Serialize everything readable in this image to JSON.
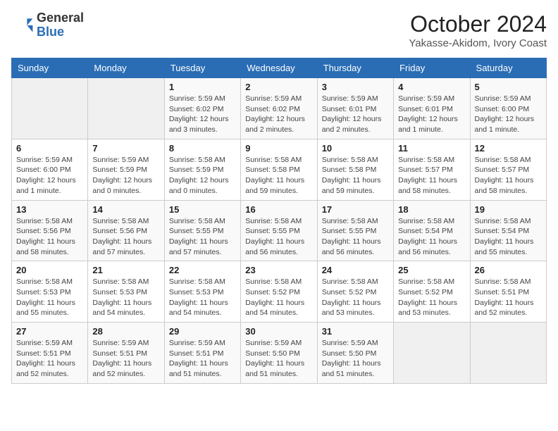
{
  "header": {
    "logo_general": "General",
    "logo_blue": "Blue",
    "month_year": "October 2024",
    "location": "Yakasse-Akidom, Ivory Coast"
  },
  "days_of_week": [
    "Sunday",
    "Monday",
    "Tuesday",
    "Wednesday",
    "Thursday",
    "Friday",
    "Saturday"
  ],
  "weeks": [
    [
      {
        "day": "",
        "detail": ""
      },
      {
        "day": "",
        "detail": ""
      },
      {
        "day": "1",
        "detail": "Sunrise: 5:59 AM\nSunset: 6:02 PM\nDaylight: 12 hours\nand 3 minutes."
      },
      {
        "day": "2",
        "detail": "Sunrise: 5:59 AM\nSunset: 6:02 PM\nDaylight: 12 hours\nand 2 minutes."
      },
      {
        "day": "3",
        "detail": "Sunrise: 5:59 AM\nSunset: 6:01 PM\nDaylight: 12 hours\nand 2 minutes."
      },
      {
        "day": "4",
        "detail": "Sunrise: 5:59 AM\nSunset: 6:01 PM\nDaylight: 12 hours\nand 1 minute."
      },
      {
        "day": "5",
        "detail": "Sunrise: 5:59 AM\nSunset: 6:00 PM\nDaylight: 12 hours\nand 1 minute."
      }
    ],
    [
      {
        "day": "6",
        "detail": "Sunrise: 5:59 AM\nSunset: 6:00 PM\nDaylight: 12 hours\nand 1 minute."
      },
      {
        "day": "7",
        "detail": "Sunrise: 5:59 AM\nSunset: 5:59 PM\nDaylight: 12 hours\nand 0 minutes."
      },
      {
        "day": "8",
        "detail": "Sunrise: 5:58 AM\nSunset: 5:59 PM\nDaylight: 12 hours\nand 0 minutes."
      },
      {
        "day": "9",
        "detail": "Sunrise: 5:58 AM\nSunset: 5:58 PM\nDaylight: 11 hours\nand 59 minutes."
      },
      {
        "day": "10",
        "detail": "Sunrise: 5:58 AM\nSunset: 5:58 PM\nDaylight: 11 hours\nand 59 minutes."
      },
      {
        "day": "11",
        "detail": "Sunrise: 5:58 AM\nSunset: 5:57 PM\nDaylight: 11 hours\nand 58 minutes."
      },
      {
        "day": "12",
        "detail": "Sunrise: 5:58 AM\nSunset: 5:57 PM\nDaylight: 11 hours\nand 58 minutes."
      }
    ],
    [
      {
        "day": "13",
        "detail": "Sunrise: 5:58 AM\nSunset: 5:56 PM\nDaylight: 11 hours\nand 58 minutes."
      },
      {
        "day": "14",
        "detail": "Sunrise: 5:58 AM\nSunset: 5:56 PM\nDaylight: 11 hours\nand 57 minutes."
      },
      {
        "day": "15",
        "detail": "Sunrise: 5:58 AM\nSunset: 5:55 PM\nDaylight: 11 hours\nand 57 minutes."
      },
      {
        "day": "16",
        "detail": "Sunrise: 5:58 AM\nSunset: 5:55 PM\nDaylight: 11 hours\nand 56 minutes."
      },
      {
        "day": "17",
        "detail": "Sunrise: 5:58 AM\nSunset: 5:55 PM\nDaylight: 11 hours\nand 56 minutes."
      },
      {
        "day": "18",
        "detail": "Sunrise: 5:58 AM\nSunset: 5:54 PM\nDaylight: 11 hours\nand 56 minutes."
      },
      {
        "day": "19",
        "detail": "Sunrise: 5:58 AM\nSunset: 5:54 PM\nDaylight: 11 hours\nand 55 minutes."
      }
    ],
    [
      {
        "day": "20",
        "detail": "Sunrise: 5:58 AM\nSunset: 5:53 PM\nDaylight: 11 hours\nand 55 minutes."
      },
      {
        "day": "21",
        "detail": "Sunrise: 5:58 AM\nSunset: 5:53 PM\nDaylight: 11 hours\nand 54 minutes."
      },
      {
        "day": "22",
        "detail": "Sunrise: 5:58 AM\nSunset: 5:53 PM\nDaylight: 11 hours\nand 54 minutes."
      },
      {
        "day": "23",
        "detail": "Sunrise: 5:58 AM\nSunset: 5:52 PM\nDaylight: 11 hours\nand 54 minutes."
      },
      {
        "day": "24",
        "detail": "Sunrise: 5:58 AM\nSunset: 5:52 PM\nDaylight: 11 hours\nand 53 minutes."
      },
      {
        "day": "25",
        "detail": "Sunrise: 5:58 AM\nSunset: 5:52 PM\nDaylight: 11 hours\nand 53 minutes."
      },
      {
        "day": "26",
        "detail": "Sunrise: 5:58 AM\nSunset: 5:51 PM\nDaylight: 11 hours\nand 52 minutes."
      }
    ],
    [
      {
        "day": "27",
        "detail": "Sunrise: 5:59 AM\nSunset: 5:51 PM\nDaylight: 11 hours\nand 52 minutes."
      },
      {
        "day": "28",
        "detail": "Sunrise: 5:59 AM\nSunset: 5:51 PM\nDaylight: 11 hours\nand 52 minutes."
      },
      {
        "day": "29",
        "detail": "Sunrise: 5:59 AM\nSunset: 5:51 PM\nDaylight: 11 hours\nand 51 minutes."
      },
      {
        "day": "30",
        "detail": "Sunrise: 5:59 AM\nSunset: 5:50 PM\nDaylight: 11 hours\nand 51 minutes."
      },
      {
        "day": "31",
        "detail": "Sunrise: 5:59 AM\nSunset: 5:50 PM\nDaylight: 11 hours\nand 51 minutes."
      },
      {
        "day": "",
        "detail": ""
      },
      {
        "day": "",
        "detail": ""
      }
    ]
  ]
}
